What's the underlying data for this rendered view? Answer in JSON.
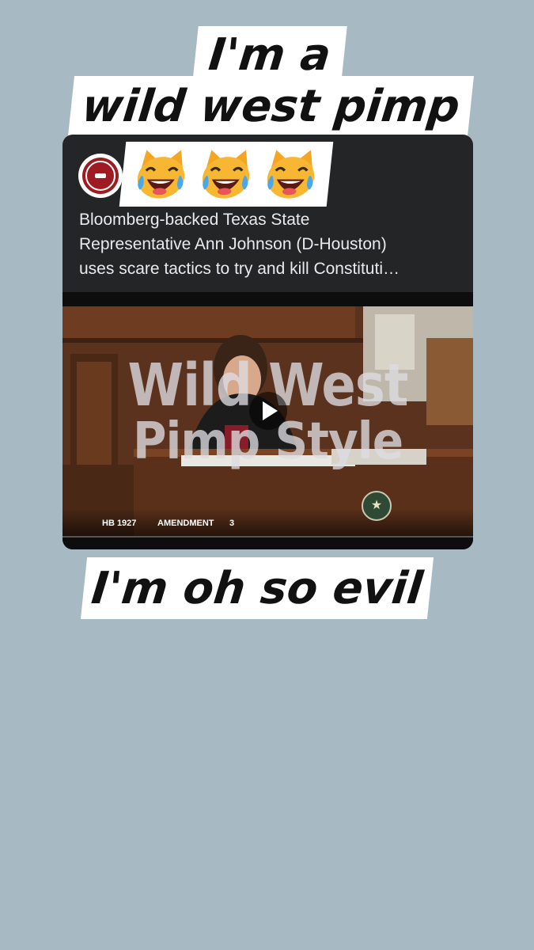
{
  "story": {
    "caption_top_line1": "I'm a",
    "caption_top_line2": "wild west pimp",
    "caption_bottom": "I'm oh so evil",
    "background_color": "#a7b9c2"
  },
  "post": {
    "avatar_icon": "texas-gun-rights-logo",
    "emoji_sticker": [
      "cat-tears-of-joy-icon",
      "cat-tears-of-joy-icon",
      "cat-tears-of-joy-icon"
    ],
    "text_lines": [
      "Bloomberg-backed Texas State",
      "Representative Ann Johnson (D-Houston)",
      "uses scare tactics to try and kill Constituti…"
    ],
    "video": {
      "overlay_line1": "Wild West",
      "overlay_line2": "Pimp Style",
      "play_icon": "play-icon",
      "lower_third_bill": "HB  1927",
      "lower_third_amendment": "AMENDMENT",
      "lower_third_number": "3",
      "seal_icon": "texas-seal-icon"
    }
  }
}
